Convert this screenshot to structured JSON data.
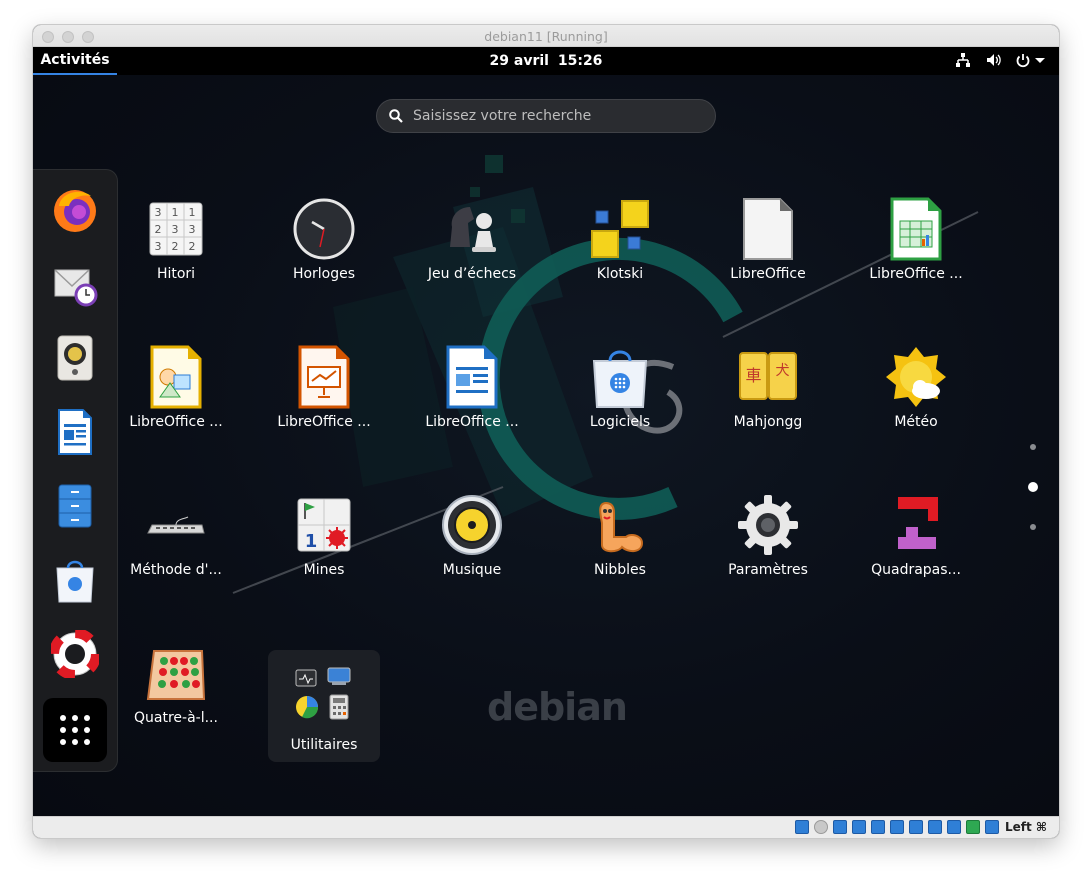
{
  "window": {
    "title": "debian11 [Running]"
  },
  "topbar": {
    "activities": "Activités",
    "date": "29 avril",
    "time": "15:26"
  },
  "search": {
    "placeholder": "Saisissez votre recherche"
  },
  "dash": {
    "items": [
      {
        "name": "firefox",
        "icon": "firefox-icon"
      },
      {
        "name": "evolution",
        "icon": "mail-clock-icon"
      },
      {
        "name": "rhythmbox",
        "icon": "speaker-icon"
      },
      {
        "name": "libreoffice-writer",
        "icon": "writer-document-icon"
      },
      {
        "name": "files",
        "icon": "file-cabinet-icon"
      },
      {
        "name": "software",
        "icon": "software-bag-icon"
      },
      {
        "name": "help",
        "icon": "lifebuoy-icon"
      },
      {
        "name": "show-applications",
        "icon": "app-grid-icon"
      }
    ]
  },
  "apps": [
    {
      "label": "Hitori",
      "icon": "hitori-icon"
    },
    {
      "label": "Horloges",
      "icon": "clock-icon"
    },
    {
      "label": "Jeu d’échecs",
      "icon": "chess-icon"
    },
    {
      "label": "Klotski",
      "icon": "klotski-icon"
    },
    {
      "label": "LibreOffice",
      "icon": "libreoffice-icon"
    },
    {
      "label": "LibreOffice ...",
      "icon": "calc-icon"
    },
    {
      "label": "LibreOffice ...",
      "icon": "draw-icon"
    },
    {
      "label": "LibreOffice ...",
      "icon": "impress-icon"
    },
    {
      "label": "LibreOffice ...",
      "icon": "writer-icon"
    },
    {
      "label": "Logiciels",
      "icon": "software-icon"
    },
    {
      "label": "Mahjongg",
      "icon": "mahjongg-icon"
    },
    {
      "label": "Météo",
      "icon": "weather-icon"
    },
    {
      "label": "Méthode d'...",
      "icon": "keyboard-icon"
    },
    {
      "label": "Mines",
      "icon": "mines-icon"
    },
    {
      "label": "Musique",
      "icon": "music-icon"
    },
    {
      "label": "Nibbles",
      "icon": "nibbles-icon"
    },
    {
      "label": "Paramètres",
      "icon": "settings-gear-icon"
    },
    {
      "label": "Quadrapas...",
      "icon": "quadrapassel-icon"
    },
    {
      "label": "Quatre-à-l...",
      "icon": "four-in-a-row-icon"
    }
  ],
  "folder": {
    "label": "Utilitaires",
    "icon": "utilities-folder-icon"
  },
  "pages": {
    "total": 3,
    "current": 2
  },
  "wallpaper": {
    "text": "debian"
  },
  "statusbar": {
    "host_key": "Left ⌘"
  },
  "colors": {
    "accent": "#3584e4",
    "topbar": "#000000",
    "dash": "#1b1c1f"
  }
}
